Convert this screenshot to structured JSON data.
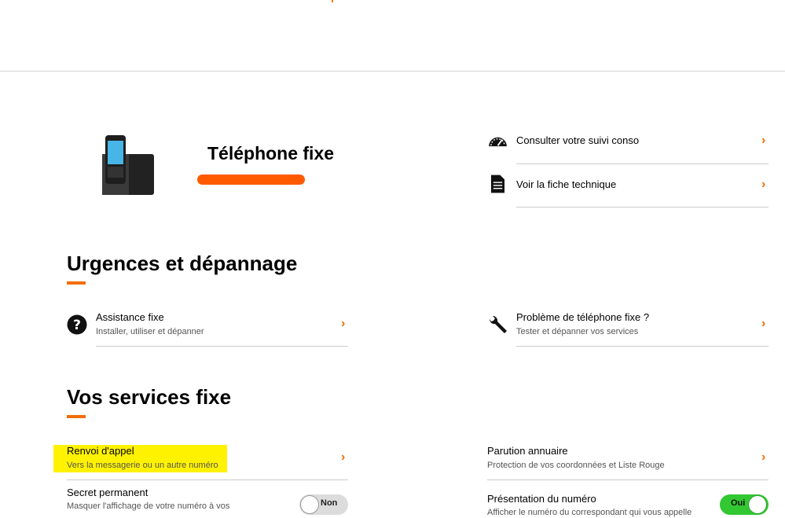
{
  "hero": {
    "title": "Téléphone fixe"
  },
  "quick_links": [
    {
      "label": "Consulter votre suivi conso",
      "icon": "speedometer-icon"
    },
    {
      "label": "Voir la fiche technique",
      "icon": "document-icon"
    }
  ],
  "sections": {
    "urgences": {
      "title": "Urgences et dépannage",
      "items": [
        {
          "label": "Assistance fixe",
          "sub": "Installer, utiliser et dépanner",
          "icon": "question-circle-icon"
        },
        {
          "label": "Problème de téléphone fixe ?",
          "sub": "Tester et dépanner vos services",
          "icon": "wrench-icon"
        }
      ]
    },
    "services": {
      "title": "Vos services fixe",
      "items": [
        {
          "label": "Renvoi d'appel",
          "sub": "Vers la messagerie ou un autre numéro"
        },
        {
          "label": "Parution annuaire",
          "sub": "Protection de vos coordonnées et Liste Rouge"
        },
        {
          "label": "Secret permanent",
          "sub": "Masquer l'affichage de votre numéro à vos",
          "toggle": "Non",
          "toggle_on": false
        },
        {
          "label": "Présentation du numéro",
          "sub": "Afficher le numéro du correspondant qui vous appelle",
          "toggle": "Oui",
          "toggle_on": true
        }
      ]
    }
  },
  "colors": {
    "accent": "#f16e00",
    "hero_underline": "#ff5a00",
    "highlight": "#fff200",
    "toggle_on": "#32c832",
    "toggle_off": "#dcdcdc"
  },
  "chevron": "›"
}
